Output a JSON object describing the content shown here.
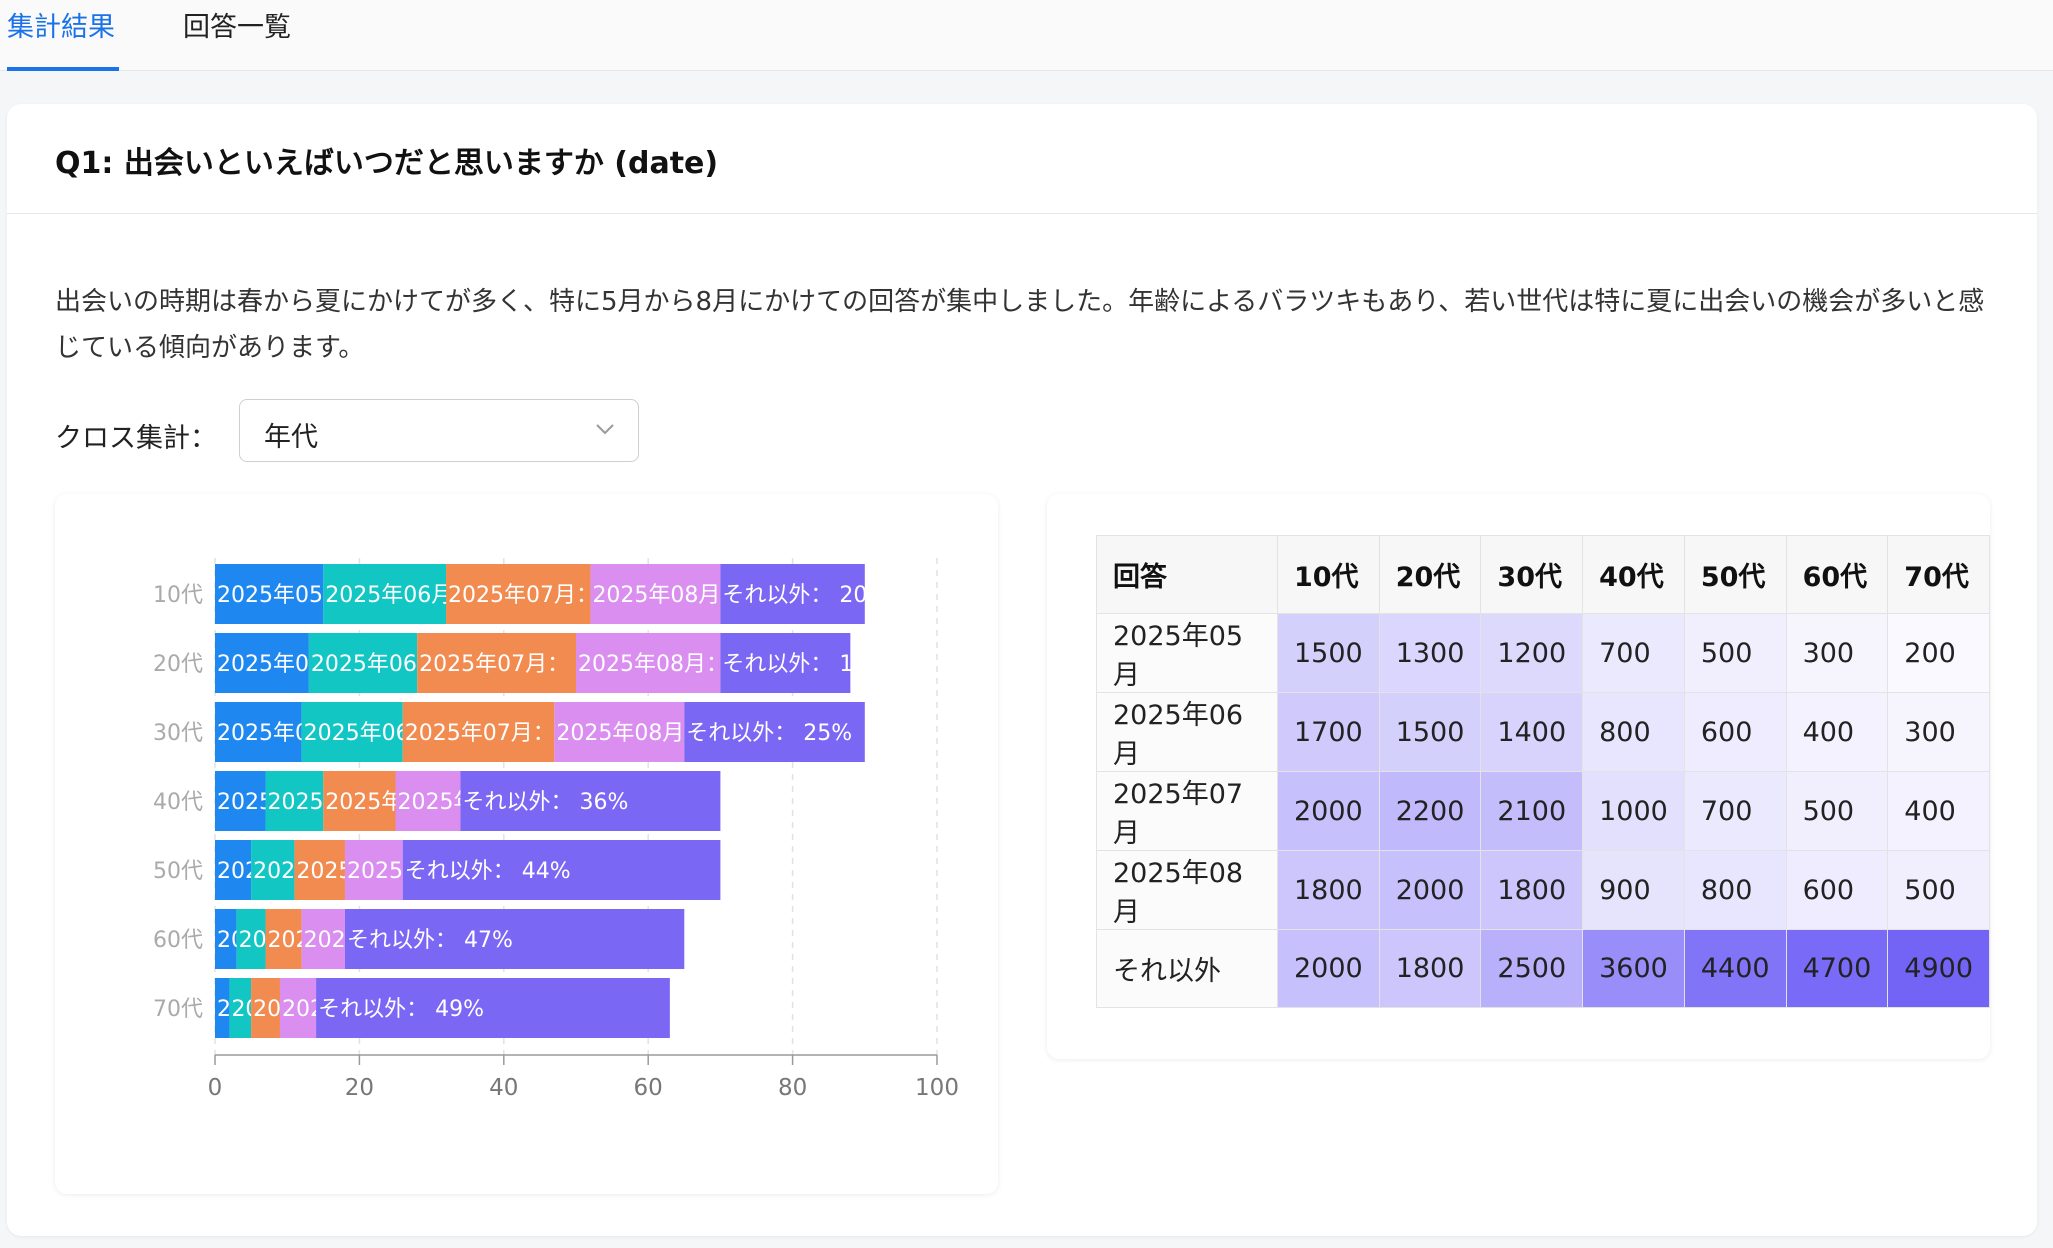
{
  "tabs": [
    {
      "label": "集計結果",
      "active": true
    },
    {
      "label": "回答一覧",
      "active": false
    }
  ],
  "question": {
    "title": "Q1: 出会いといえばいつだと思いますか (date)",
    "description": "出会いの時期は春から夏にかけてが多く、特に5月から8月にかけての回答が集中しました。年齢によるバラツキもあり、若い世代は特に夏に出会いの機会が多いと感じている傾向があります。"
  },
  "cross": {
    "label": "クロス集計：",
    "selected": "年代",
    "chevron_icon": "chevron-down-icon"
  },
  "colors": {
    "accent": "#1a73e8",
    "series": [
      "#1e88f0",
      "#12c6c4",
      "#f28b4f",
      "#d98ef0",
      "#7a68f5"
    ]
  },
  "chart_data": {
    "type": "bar",
    "orientation": "horizontal",
    "stacked": true,
    "categories": [
      "10代",
      "20代",
      "30代",
      "40代",
      "50代",
      "60代",
      "70代"
    ],
    "series": [
      {
        "name": "2025年05月",
        "values": [
          15,
          13,
          12,
          7,
          5,
          3,
          2
        ]
      },
      {
        "name": "2025年06月",
        "values": [
          17,
          15,
          14,
          8,
          6,
          4,
          3
        ]
      },
      {
        "name": "2025年07月",
        "values": [
          20,
          22,
          21,
          10,
          7,
          5,
          4
        ]
      },
      {
        "name": "2025年08月",
        "values": [
          18,
          20,
          18,
          9,
          8,
          6,
          5
        ]
      },
      {
        "name": "それ以外",
        "values": [
          20,
          18,
          25,
          36,
          44,
          47,
          49
        ]
      }
    ],
    "xlim": [
      0,
      100
    ],
    "xticks": [
      0,
      20,
      40,
      60,
      80,
      100
    ],
    "grid": true,
    "legend": "none"
  },
  "table": {
    "corner": "回答",
    "columns": [
      "10代",
      "20代",
      "30代",
      "40代",
      "50代",
      "60代",
      "70代"
    ],
    "rows": [
      {
        "label": "2025年05月",
        "values": [
          1500,
          1300,
          1200,
          700,
          500,
          300,
          200
        ]
      },
      {
        "label": "2025年06月",
        "values": [
          1700,
          1500,
          1400,
          800,
          600,
          400,
          300
        ]
      },
      {
        "label": "2025年07月",
        "values": [
          2000,
          2200,
          2100,
          1000,
          700,
          500,
          400
        ]
      },
      {
        "label": "2025年08月",
        "values": [
          1800,
          2000,
          1800,
          900,
          800,
          600,
          500
        ]
      },
      {
        "label": "それ以外",
        "values": [
          2000,
          1800,
          2500,
          3600,
          4400,
          4700,
          4900
        ]
      }
    ],
    "heat_color": "#6c5cf6"
  }
}
